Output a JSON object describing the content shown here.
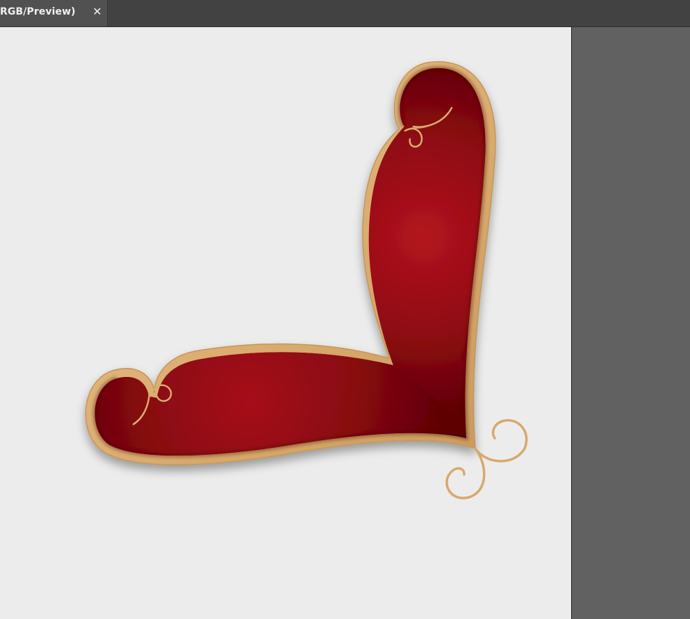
{
  "document_tab": {
    "title": "RGB/Preview)",
    "close_glyph": "✕"
  },
  "colors": {
    "tabbar_bg": "#424242",
    "active_tab_bg": "#515151",
    "pasteboard_bg": "#616161",
    "artboard_bg": "#ececec",
    "ornament_fill_light": "#b3141e",
    "ornament_fill_dark": "#5e0004",
    "ornament_gold": "#e2b57a",
    "ornament_gold_dark": "#c59658"
  },
  "artwork": {
    "description_icon": "red-gold-corner-ornament"
  }
}
